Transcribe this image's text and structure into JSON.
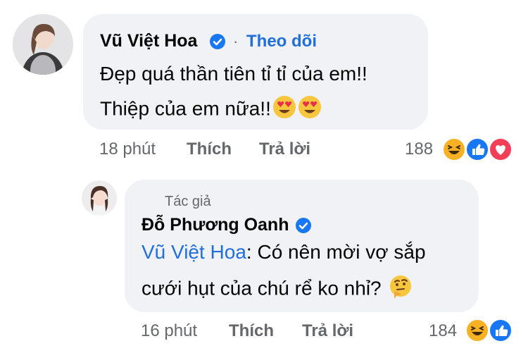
{
  "comment": {
    "author": "Vũ Việt Hoa",
    "separator": "·",
    "follow_label": "Theo dõi",
    "line1": "Đẹp quá thần tiên tỉ tỉ của em!!",
    "line2": "Thiệp của em nữa!!",
    "time": "18 phút",
    "like_label": "Thích",
    "reply_label": "Trả lời",
    "reaction_count": "188"
  },
  "reply": {
    "author_label": "Tác giả",
    "author": "Đỗ Phương Oanh",
    "mention": "Vũ Việt Hoa",
    "text_after_mention": ": Có nên mời vợ sắp",
    "line2": "cưới hụt của chú rể ko nhỉ?",
    "time": "16 phút",
    "like_label": "Thích",
    "reply_label": "Trả lời",
    "reaction_count": "184"
  },
  "colors": {
    "bubble": "#f0f2f5",
    "link_blue": "#216fdb",
    "meta_gray": "#65676b",
    "verified_blue": "#1877f2",
    "love_red": "#f33e58",
    "haha_yellow": "#f7b125"
  },
  "icons": [
    "verified-icon",
    "heart-eyes-emoji-icon",
    "thinking-emoji-icon",
    "haha-reaction-icon",
    "like-reaction-icon",
    "love-reaction-icon"
  ]
}
